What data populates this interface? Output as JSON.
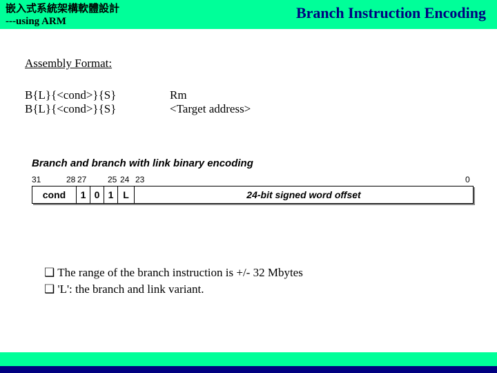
{
  "header": {
    "course_title": "嵌入式系統架構軟體設計",
    "course_sub": "---using ARM",
    "slide_title": "Branch Instruction Encoding"
  },
  "section_heading": "Assembly Format:",
  "fmt": {
    "l1_left": "B{L}{<cond>}{S}",
    "l1_right": "Rm",
    "l2_left": "B{L}{<cond>}{S}",
    "l2_right": "<Target address>"
  },
  "diagram": {
    "title": "Branch and branch with link binary encoding",
    "bits": {
      "b31": "31",
      "b28": "28",
      "b27": "27",
      "b25": "25",
      "b24": "24",
      "b23": "23",
      "b0": "0"
    },
    "fields": {
      "cond": "cond",
      "bit1": "1",
      "bit2": "0",
      "bit3": "1",
      "lbit": "L",
      "offset": "24-bit signed word offset"
    }
  },
  "bullets": {
    "b1": "The  range of the branch instruction is +/- 32 Mbytes",
    "b2": "'L': the branch and link variant."
  }
}
